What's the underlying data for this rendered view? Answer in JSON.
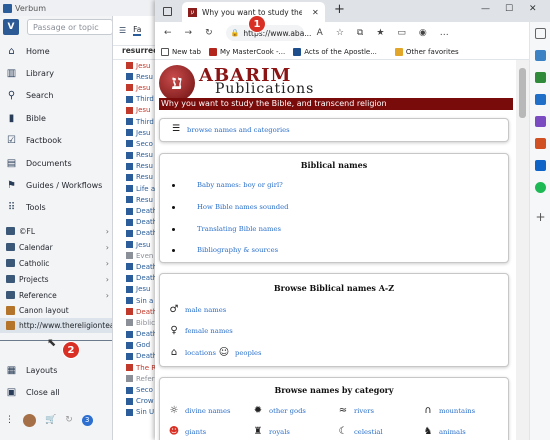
{
  "verbum": {
    "window_title": "Verbum",
    "search_placeholder": "Passage or topic",
    "nav": [
      {
        "label": "Home",
        "icon": "home-icon",
        "glyph": "⌂"
      },
      {
        "label": "Library",
        "icon": "library-icon",
        "glyph": "▥"
      },
      {
        "label": "Search",
        "icon": "search-icon",
        "glyph": "⚲"
      },
      {
        "label": "Bible",
        "icon": "bible-icon",
        "glyph": "▮"
      },
      {
        "label": "Factbook",
        "icon": "factbook-icon",
        "glyph": "☑"
      },
      {
        "label": "Documents",
        "icon": "documents-icon",
        "glyph": "▤"
      },
      {
        "label": "Guides / Workflows",
        "icon": "guides-icon",
        "glyph": "⚑"
      },
      {
        "label": "Tools",
        "icon": "tools-icon",
        "glyph": "⠿"
      }
    ],
    "folders": [
      {
        "label": "©FL"
      },
      {
        "label": "Calendar"
      },
      {
        "label": "Catholic"
      },
      {
        "label": "Projects"
      },
      {
        "label": "Reference"
      }
    ],
    "layouts": [
      {
        "label": "Canon layout"
      },
      {
        "label": "http://www.thereligiontea..."
      }
    ],
    "bottom_nav": [
      {
        "label": "Layouts",
        "icon": "layouts-icon",
        "glyph": "▦"
      },
      {
        "label": "Close all",
        "icon": "close-all-icon",
        "glyph": "▣"
      }
    ],
    "badge_count": "3"
  },
  "midcol": {
    "tab_label": "Fa",
    "search_text": "resurrec",
    "rows": [
      {
        "text": "Jesu",
        "color": "#c0392b"
      },
      {
        "text": "Resu",
        "color": "#2a5d99"
      },
      {
        "text": "Jesu",
        "color": "#c0392b"
      },
      {
        "text": "Third",
        "color": "#2a5d99"
      },
      {
        "text": "Jesu",
        "color": "#c0392b"
      },
      {
        "text": "Third",
        "color": "#2a5d99"
      },
      {
        "text": "Jesu",
        "color": "#2a5d99"
      },
      {
        "text": "Seco",
        "color": "#2a5d99"
      },
      {
        "text": "Resu",
        "color": "#2a5d99"
      },
      {
        "text": "Resu",
        "color": "#2a5d99"
      },
      {
        "text": "Resu",
        "color": "#2a5d99"
      },
      {
        "text": "Life a",
        "color": "#2a5d99"
      },
      {
        "text": "Resu",
        "color": "#2a5d99"
      },
      {
        "text": "Death",
        "color": "#2a5d99"
      },
      {
        "text": "Death",
        "color": "#2a5d99"
      },
      {
        "text": "Death",
        "color": "#2a5d99"
      },
      {
        "text": "Jesu",
        "color": "#2a5d99"
      },
      {
        "text": "Even",
        "color": "#8a8f98"
      },
      {
        "text": "Death",
        "color": "#2a5d99"
      },
      {
        "text": "Death",
        "color": "#2a5d99"
      },
      {
        "text": "Jesu",
        "color": "#2a5d99"
      },
      {
        "text": "Sin a",
        "color": "#2a5d99"
      },
      {
        "text": "Death",
        "color": "#c0392b"
      },
      {
        "text": "Biblic",
        "color": "#8a8f98"
      },
      {
        "text": "Death",
        "color": "#2a5d99"
      },
      {
        "text": "God",
        "color": "#2a5d99"
      },
      {
        "text": "Death",
        "color": "#2a5d99"
      },
      {
        "text": "The R",
        "color": "#c0392b"
      },
      {
        "text": "Refer",
        "color": "#8a8f98"
      },
      {
        "text": "Seco",
        "color": "#2a5d99"
      },
      {
        "text": "Crow",
        "color": "#2a5d99"
      },
      {
        "text": "Sin U",
        "color": "#2a5d99"
      }
    ]
  },
  "edge": {
    "tab_title": "Why you want to study the Bible, and transcend religion",
    "tab_favicon": "ע",
    "address": "https://www.aba...",
    "favorites": [
      {
        "label": "New tab",
        "color": "#555555"
      },
      {
        "label": "My MasterCook -...",
        "color": "#b3261e"
      },
      {
        "label": "Acts of the Apostle...",
        "color": "#1f4e8c"
      },
      {
        "label": "Other favorites",
        "color": "#e2a62b"
      }
    ]
  },
  "page": {
    "logo_glyph": "ע",
    "site_title": "ABARIM",
    "site_subtitle": "Publications",
    "banner": "Why you want to study the Bible, and transcend religion",
    "menu_link": "browse names and categories",
    "biblical_names": {
      "title": "Biblical names",
      "links": [
        "Baby names: boy or girl?",
        "How Bible names sounded",
        "Translating Bible names",
        "Bibliography & sources"
      ]
    },
    "browse_az": {
      "title": "Browse Biblical names A-Z",
      "male": "male names",
      "female": "female names",
      "locations": "locations",
      "peoples": "peoples"
    },
    "by_category": {
      "title": "Browse names by category",
      "items": [
        {
          "label": "divine names",
          "glyph": "☼"
        },
        {
          "label": "other gods",
          "glyph": "✹"
        },
        {
          "label": "rivers",
          "glyph": "≈"
        },
        {
          "label": "mountains",
          "glyph": "∩"
        },
        {
          "label": "giants",
          "glyph": "☻"
        },
        {
          "label": "royals",
          "glyph": "♜"
        },
        {
          "label": "celestial",
          "glyph": "☾"
        },
        {
          "label": "animals",
          "glyph": "♞"
        }
      ]
    }
  },
  "annotations": {
    "marker1": "1",
    "marker2": "2"
  }
}
